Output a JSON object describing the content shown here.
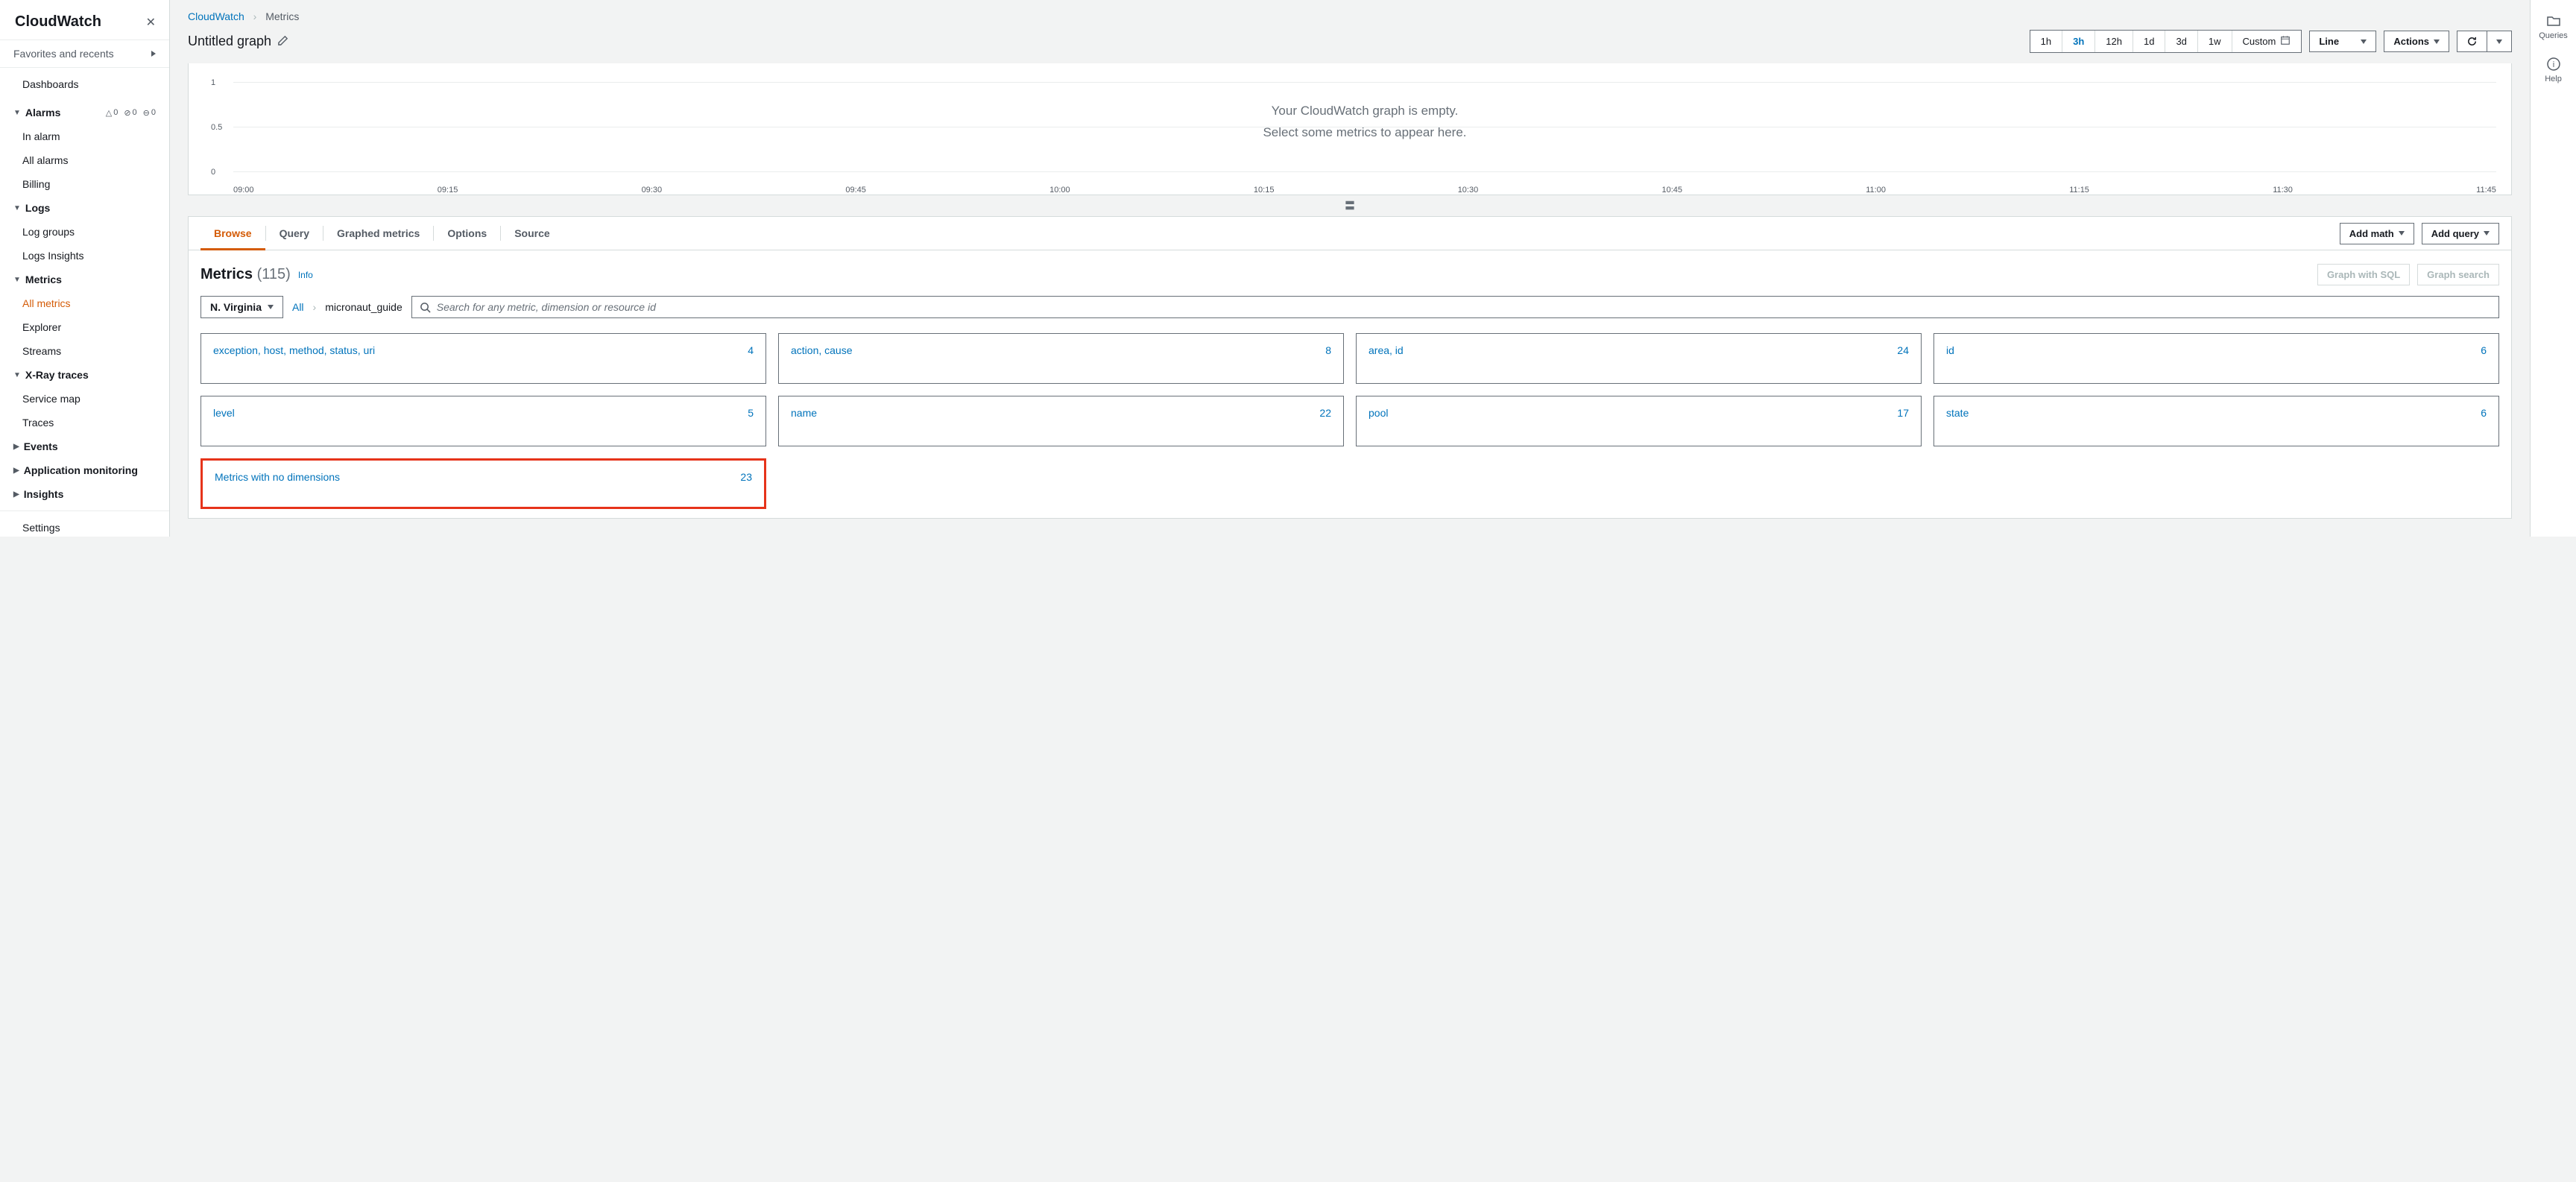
{
  "sidebar": {
    "title": "CloudWatch",
    "favorites": "Favorites and recents",
    "dashboards": "Dashboards",
    "alarms_label": "Alarms",
    "alarms_badges": {
      "tri": "0",
      "ok": "0",
      "dots": "0"
    },
    "alarms": [
      "In alarm",
      "All alarms",
      "Billing"
    ],
    "logs_label": "Logs",
    "logs": [
      "Log groups",
      "Logs Insights"
    ],
    "metrics_label": "Metrics",
    "metrics": [
      "All metrics",
      "Explorer",
      "Streams"
    ],
    "xray_label": "X-Ray traces",
    "xray": [
      "Service map",
      "Traces"
    ],
    "events": "Events",
    "appmon": "Application monitoring",
    "insights": "Insights",
    "settings": "Settings"
  },
  "breadcrumb": {
    "root": "CloudWatch",
    "leaf": "Metrics"
  },
  "graph": {
    "title": "Untitled graph",
    "empty1": "Your CloudWatch graph is empty.",
    "empty2": "Select some metrics to appear here."
  },
  "time_ranges": [
    "1h",
    "3h",
    "12h",
    "1d",
    "3d",
    "1w",
    "Custom"
  ],
  "graph_type": "Line",
  "actions_label": "Actions",
  "chart_data": {
    "type": "line",
    "y_ticks": [
      0,
      0.5,
      1
    ],
    "x_ticks": [
      "09:00",
      "09:15",
      "09:30",
      "09:45",
      "10:00",
      "10:15",
      "10:30",
      "10:45",
      "11:00",
      "11:15",
      "11:30",
      "11:45"
    ],
    "series": []
  },
  "tabs": [
    "Browse",
    "Query",
    "Graphed metrics",
    "Options",
    "Source"
  ],
  "tab_buttons": {
    "add_math": "Add math",
    "add_query": "Add query"
  },
  "metrics_header": {
    "label": "Metrics",
    "count": "(115)",
    "info": "Info",
    "gsql": "Graph with SQL",
    "gsearch": "Graph search"
  },
  "filter": {
    "region": "N. Virginia",
    "root": "All",
    "ns": "micronaut_guide",
    "placeholder": "Search for any metric, dimension or resource id"
  },
  "cards": [
    {
      "name": "exception, host, method, status, uri",
      "count": "4"
    },
    {
      "name": "action, cause",
      "count": "8"
    },
    {
      "name": "area, id",
      "count": "24"
    },
    {
      "name": "id",
      "count": "6"
    },
    {
      "name": "level",
      "count": "5"
    },
    {
      "name": "name",
      "count": "22"
    },
    {
      "name": "pool",
      "count": "17"
    },
    {
      "name": "state",
      "count": "6"
    },
    {
      "name": "Metrics with no dimensions",
      "count": "23",
      "highlight": true
    }
  ],
  "rail": {
    "queries": "Queries",
    "help": "Help"
  }
}
